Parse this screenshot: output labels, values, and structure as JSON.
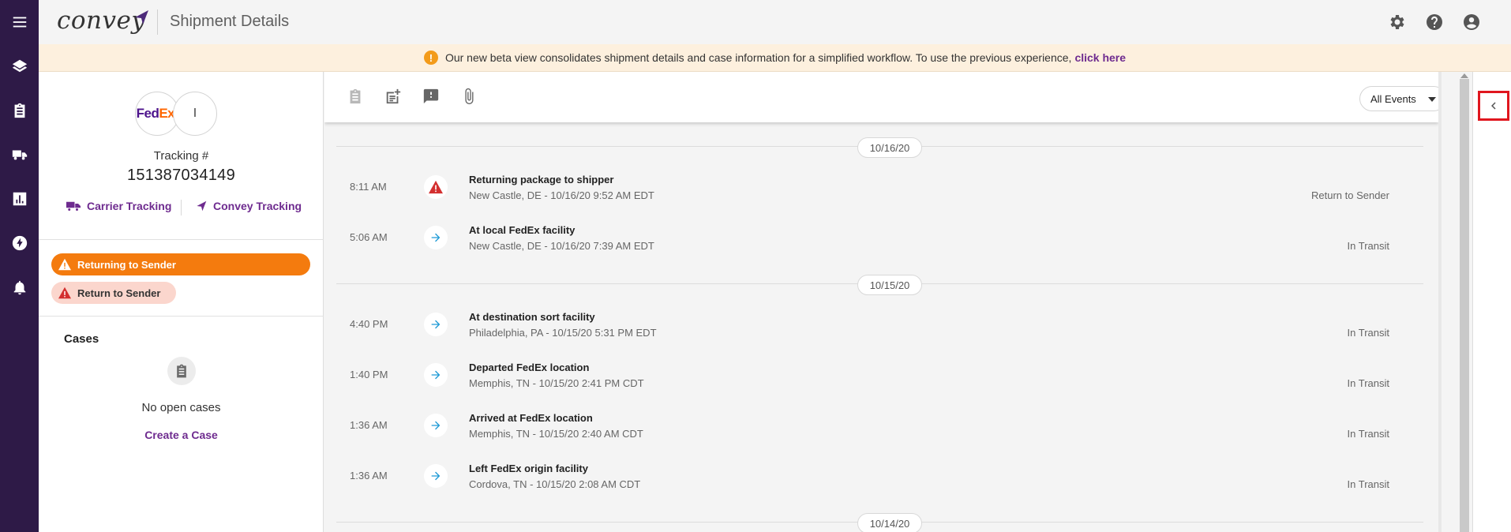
{
  "app": {
    "brand": "convey",
    "page_title": "Shipment Details"
  },
  "banner": {
    "message": "Our new beta view consolidates shipment details and case information for a simplified workflow. To use the previous experience,",
    "link": "click here",
    "icon": "exclamation-icon",
    "color": "#f39b1a"
  },
  "shipment": {
    "carrier_logo_fed": "Fed",
    "carrier_logo_ex": "Ex.",
    "retailer_initial": "I",
    "tracking_label": "Tracking #",
    "tracking_number": "151387034149",
    "carrier_tracking": "Carrier Tracking",
    "convey_tracking": "Convey Tracking"
  },
  "statuses": [
    {
      "label": "Returning to Sender",
      "color": "#f47b0e"
    },
    {
      "label": "Return to Sender",
      "color": "#fbd6cd"
    }
  ],
  "cases": {
    "title": "Cases",
    "empty": "No open cases",
    "create": "Create a Case"
  },
  "filter": {
    "selected": "All Events"
  },
  "timeline": {
    "groups": [
      {
        "date": "10/16/20",
        "events": [
          {
            "time": "8:11 AM",
            "icon": "warning-icon",
            "title": "Returning package to shipper",
            "location": "New Castle, DE - 10/16/20 9:52 AM EDT",
            "status": "Return to Sender"
          },
          {
            "time": "5:06 AM",
            "icon": "arrow-right-icon",
            "title": "At local FedEx facility",
            "location": "New Castle, DE - 10/16/20 7:39 AM EDT",
            "status": "In Transit"
          }
        ]
      },
      {
        "date": "10/15/20",
        "events": [
          {
            "time": "4:40 PM",
            "icon": "arrow-right-icon",
            "title": "At destination sort facility",
            "location": "Philadelphia, PA - 10/15/20 5:31 PM EDT",
            "status": "In Transit"
          },
          {
            "time": "1:40 PM",
            "icon": "arrow-right-icon",
            "title": "Departed FedEx location",
            "location": "Memphis, TN - 10/15/20 2:41 PM CDT",
            "status": "In Transit"
          },
          {
            "time": "1:36 AM",
            "icon": "arrow-right-icon",
            "title": "Arrived at FedEx location",
            "location": "Memphis, TN - 10/15/20 2:40 AM CDT",
            "status": "In Transit"
          },
          {
            "time": "1:36 AM",
            "icon": "arrow-right-icon",
            "title": "Left FedEx origin facility",
            "location": "Cordova, TN - 10/15/20 2:08 AM CDT",
            "status": "In Transit"
          }
        ]
      },
      {
        "date": "10/14/20",
        "events": []
      }
    ]
  },
  "colors": {
    "nav": "#2e1a47",
    "accent": "#6e2b8f",
    "warning": "#d32f2f",
    "transit": "#1e9ad6",
    "highlight": "#e0161e"
  }
}
